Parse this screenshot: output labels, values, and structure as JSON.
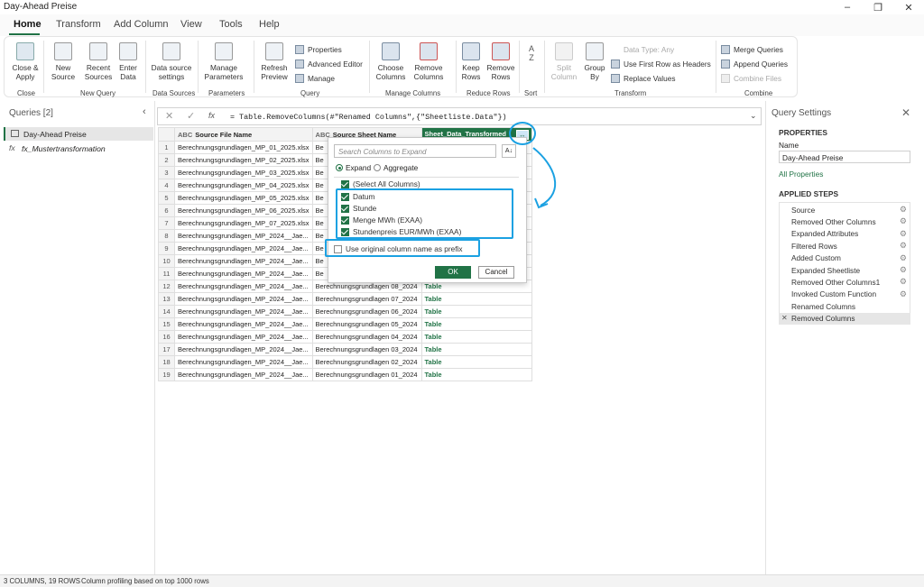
{
  "window": {
    "title": "Day-Ahead Preise"
  },
  "tabs": [
    "Home",
    "Transform",
    "Add Column",
    "View",
    "Tools",
    "Help"
  ],
  "ribbon": {
    "close_apply": [
      "Close &",
      "Apply"
    ],
    "new_source": [
      "New",
      "Source"
    ],
    "recent_sources": [
      "Recent",
      "Sources"
    ],
    "enter_data": [
      "Enter",
      "Data"
    ],
    "data_source_settings": [
      "Data source",
      "settings"
    ],
    "manage_parameters": [
      "Manage",
      "Parameters"
    ],
    "refresh_preview": [
      "Refresh",
      "Preview"
    ],
    "properties": "Properties",
    "advanced_editor": "Advanced Editor",
    "manage": "Manage",
    "choose_columns": [
      "Choose",
      "Columns"
    ],
    "remove_columns": [
      "Remove",
      "Columns"
    ],
    "keep_rows": [
      "Keep",
      "Rows"
    ],
    "remove_rows": [
      "Remove",
      "Rows"
    ],
    "split_column": [
      "Split",
      "Column"
    ],
    "group_by": [
      "Group",
      "By"
    ],
    "data_type": "Data Type: Any",
    "use_first_row": "Use First Row as Headers",
    "replace_values": "Replace Values",
    "merge_queries": "Merge Queries",
    "append_queries": "Append Queries",
    "combine_files": "Combine Files",
    "groups": [
      "Close",
      "New Query",
      "Data Sources",
      "Parameters",
      "Query",
      "Manage Columns",
      "Reduce Rows",
      "Sort",
      "Transform",
      "Combine"
    ]
  },
  "queries": {
    "header": "Queries [2]",
    "items": [
      {
        "label": "Day-Ahead Preise"
      },
      {
        "label": "fx_Mustertransformation"
      }
    ]
  },
  "formula": "= Table.RemoveColumns(#\"Renamed Columns\",{\"Sheetliste.Data\"})",
  "grid": {
    "columns": [
      "Source File Name",
      "Source Sheet Name",
      "Sheet_Data_Transformed"
    ],
    "rows": [
      [
        "1",
        "Berechnungsgrundlagen_MP_01_2025.xlsx",
        "Be",
        ""
      ],
      [
        "2",
        "Berechnungsgrundlagen_MP_02_2025.xlsx",
        "Be",
        ""
      ],
      [
        "3",
        "Berechnungsgrundlagen_MP_03_2025.xlsx",
        "Be",
        ""
      ],
      [
        "4",
        "Berechnungsgrundlagen_MP_04_2025.xlsx",
        "Be",
        ""
      ],
      [
        "5",
        "Berechnungsgrundlagen_MP_05_2025.xlsx",
        "Be",
        ""
      ],
      [
        "6",
        "Berechnungsgrundlagen_MP_06_2025.xlsx",
        "Be",
        ""
      ],
      [
        "7",
        "Berechnungsgrundlagen_MP_07_2025.xlsx",
        "Be",
        ""
      ],
      [
        "8",
        "Berechnungsgrundlagen_MP_2024__Jae...",
        "Be",
        ""
      ],
      [
        "9",
        "Berechnungsgrundlagen_MP_2024__Jae...",
        "Be",
        ""
      ],
      [
        "10",
        "Berechnungsgrundlagen_MP_2024__Jae...",
        "Be",
        ""
      ],
      [
        "11",
        "Berechnungsgrundlagen_MP_2024__Jae...",
        "Be",
        ""
      ],
      [
        "12",
        "Berechnungsgrundlagen_MP_2024__Jae...",
        "Berechnungsgrundlagen 08_2024",
        "Table"
      ],
      [
        "13",
        "Berechnungsgrundlagen_MP_2024__Jae...",
        "Berechnungsgrundlagen 07_2024",
        "Table"
      ],
      [
        "14",
        "Berechnungsgrundlagen_MP_2024__Jae...",
        "Berechnungsgrundlagen 06_2024",
        "Table"
      ],
      [
        "15",
        "Berechnungsgrundlagen_MP_2024__Jae...",
        "Berechnungsgrundlagen 05_2024",
        "Table"
      ],
      [
        "16",
        "Berechnungsgrundlagen_MP_2024__Jae...",
        "Berechnungsgrundlagen 04_2024",
        "Table"
      ],
      [
        "17",
        "Berechnungsgrundlagen_MP_2024__Jae...",
        "Berechnungsgrundlagen 03_2024",
        "Table"
      ],
      [
        "18",
        "Berechnungsgrundlagen_MP_2024__Jae...",
        "Berechnungsgrundlagen 02_2024",
        "Table"
      ],
      [
        "19",
        "Berechnungsgrundlagen_MP_2024__Jae...",
        "Berechnungsgrundlagen 01_2024",
        "Table"
      ]
    ]
  },
  "expand_popup": {
    "search_placeholder": "Search Columns to Expand",
    "expand_label": "Expand",
    "aggregate_label": "Aggregate",
    "select_all": "(Select All Columns)",
    "columns": [
      "Datum",
      "Stunde",
      "Menge MWh (EXAA)",
      "Stundenpreis EUR/MWh (EXAA)"
    ],
    "prefix_label": "Use original column name as prefix",
    "ok": "OK",
    "cancel": "Cancel"
  },
  "query_settings": {
    "title": "Query Settings",
    "properties_header": "PROPERTIES",
    "name_label": "Name",
    "name_value": "Day-Ahead Preise",
    "all_properties": "All Properties",
    "steps_header": "APPLIED STEPS",
    "steps": [
      "Source",
      "Removed Other Columns",
      "Expanded Attributes",
      "Filtered Rows",
      "Added Custom",
      "Expanded Sheetliste",
      "Removed Other Columns1",
      "Invoked Custom Function",
      "Renamed Columns",
      "Removed Columns"
    ]
  },
  "status": {
    "left": "3 COLUMNS, 19 ROWS",
    "right": "Column profiling based on top 1000 rows"
  },
  "colors": {
    "accent": "#217346",
    "highlight": "#1ba1e2"
  }
}
